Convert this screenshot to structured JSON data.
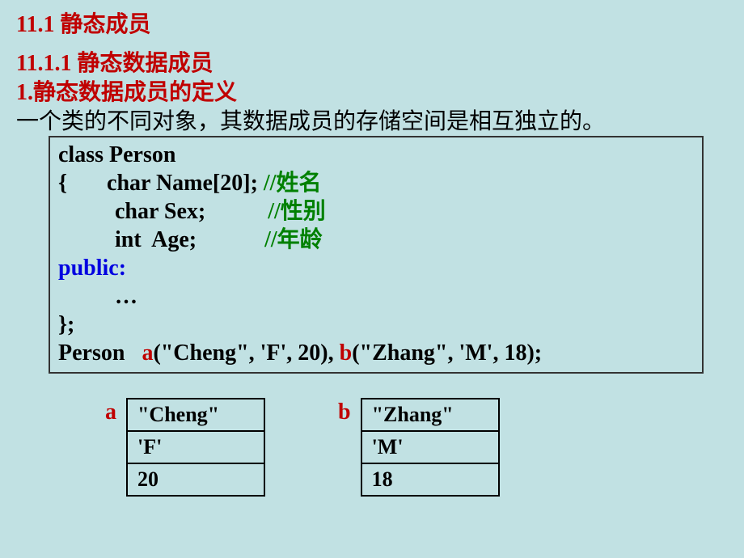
{
  "headings": {
    "h1": "11.1 静态成员",
    "h2": "11.1.1  静态数据成员",
    "h3": "1.静态数据成员的定义"
  },
  "body_text": "一个类的不同对象，其数据成员的存储空间是相互独立的。",
  "code": {
    "l1": "class Person",
    "l2a": "{       char Name[20]; ",
    "l2b": "//姓名",
    "l3a": "          char Sex;           ",
    "l3b": "//性别",
    "l4a": "          int  Age;            ",
    "l4b": "//年龄",
    "l5": "public:",
    "l6": "          …",
    "l7": "};",
    "l8a": "Person   ",
    "l8b": "a",
    "l8c": "(\"Cheng\", 'F', 20), ",
    "l8d": "b",
    "l8e": "(\"Zhang\", 'M', 18);"
  },
  "tables": {
    "a": {
      "label": "a",
      "rows": [
        "\"Cheng\"",
        "'F'",
        "20"
      ]
    },
    "b": {
      "label": "b",
      "rows": [
        "\"Zhang\"",
        "'M'",
        "18"
      ]
    }
  }
}
